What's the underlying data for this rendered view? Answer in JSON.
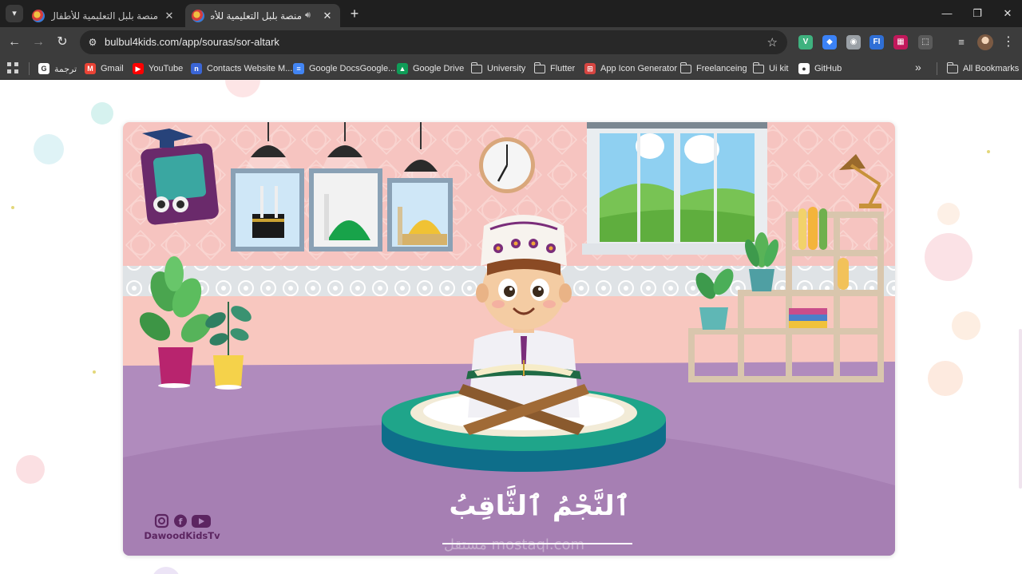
{
  "browser": {
    "tabs": [
      {
        "title": "منصة بلبل التعليمية للأطفال",
        "active": false
      },
      {
        "title": "منصة بلبل التعليمية للأطفال",
        "active": true
      }
    ],
    "url": "bulbul4kids.com/app/souras/sor-altark",
    "extensions": [
      {
        "name": "vue-devtools-icon",
        "label": "V",
        "color": "#3fb27f"
      },
      {
        "name": "ethereum-icon",
        "label": "◆",
        "color": "#3b82f6"
      },
      {
        "name": "camera-icon",
        "label": "◉",
        "color": "#9aa0a6"
      },
      {
        "name": "figma-plugin-icon",
        "label": "FI",
        "color": "#2f6fd6"
      },
      {
        "name": "screen-capture-icon",
        "label": "▦",
        "color": "#c2185b"
      },
      {
        "name": "extensions-puzzle-icon",
        "label": "⬚",
        "color": "#5a5a5a"
      }
    ]
  },
  "bookmarks": [
    {
      "label": "ترجمة",
      "icon": "google-translate-icon",
      "color": "#ffffff",
      "glyph": "G"
    },
    {
      "label": "Gmail",
      "icon": "gmail-icon",
      "color": "#ea4335",
      "glyph": "M"
    },
    {
      "label": "YouTube",
      "icon": "youtube-icon",
      "color": "#ff0000",
      "glyph": "▶"
    },
    {
      "label": "Contacts Website M...",
      "icon": "contacts-icon",
      "color": "#3b66d6",
      "glyph": "n"
    },
    {
      "label": "Google DocsGoogle...",
      "icon": "google-docs-icon",
      "color": "#4285f4",
      "glyph": "≡"
    },
    {
      "label": "Google Drive",
      "icon": "google-drive-icon",
      "color": "#0f9d58",
      "glyph": "▲"
    },
    {
      "label": "University",
      "icon": "folder-icon",
      "folder": true
    },
    {
      "label": "Flutter",
      "icon": "folder-icon",
      "folder": true
    },
    {
      "label": "App Icon Generator",
      "icon": "app-icon-generator-icon",
      "color": "#d64541",
      "glyph": "⊞"
    },
    {
      "label": "Freelanceing",
      "icon": "folder-icon",
      "folder": true
    },
    {
      "label": "Ui kit",
      "icon": "folder-icon",
      "folder": true
    },
    {
      "label": "GitHub",
      "icon": "github-icon",
      "color": "#ffffff",
      "glyph": "●"
    }
  ],
  "all_bookmarks_label": "All Bookmarks",
  "video": {
    "surah_title": "ٱلنَّجْمُ ٱلثَّاقِبُ",
    "channel_name": "DawoodKidsTv",
    "watermark": "مستقل mostaql.com",
    "colors": {
      "wall": "#f6c4c0",
      "floor": "#b388bf",
      "rug": "#1e9e88",
      "accent": "#7a2d7a"
    }
  }
}
